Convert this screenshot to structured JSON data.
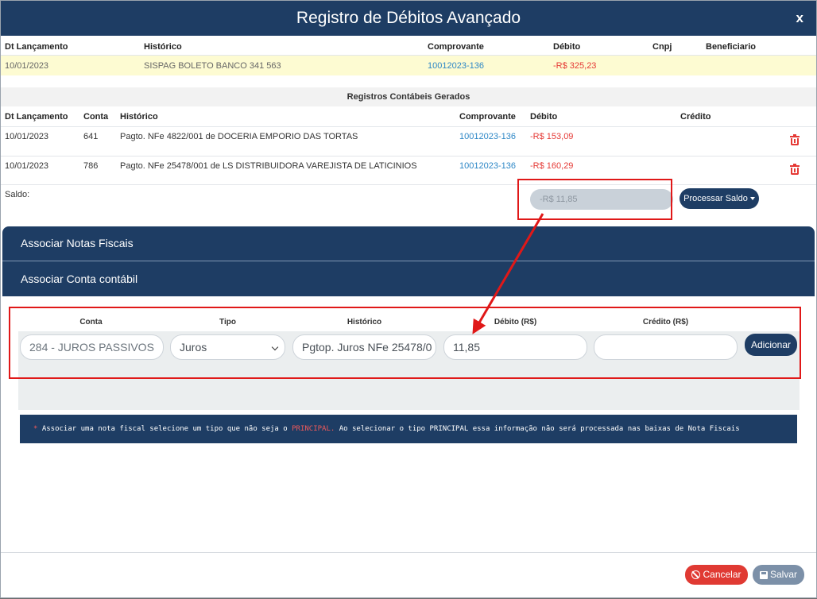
{
  "modal": {
    "title": "Registro de Débitos Avançado",
    "close_label": "x"
  },
  "top_table": {
    "headers": {
      "dt": "Dt Lançamento",
      "historico": "Histórico",
      "comprovante": "Comprovante",
      "debito": "Débito",
      "cnpj": "Cnpj",
      "beneficiario": "Beneficiario"
    },
    "row": {
      "dt": "10/01/2023",
      "historico": "SISPAG BOLETO BANCO 341 563",
      "comprovante": "10012023-136",
      "debito": "-R$ 325,23"
    }
  },
  "generated": {
    "title": "Registros Contábeis Gerados",
    "headers": {
      "dt": "Dt Lançamento",
      "conta": "Conta",
      "historico": "Histórico",
      "comprovante": "Comprovante",
      "debito": "Débito",
      "credito": "Crédito"
    },
    "rows": [
      {
        "dt": "10/01/2023",
        "conta": "641",
        "historico": "Pagto. NFe 4822/001 de DOCERIA EMPORIO DAS TORTAS",
        "comprovante": "10012023-136",
        "debito": "-R$ 153,09"
      },
      {
        "dt": "10/01/2023",
        "conta": "786",
        "historico": "Pagto. NFe 25478/001 de LS DISTRIBUIDORA VAREJISTA DE LATICINIOS",
        "comprovante": "10012023-136",
        "debito": "-R$ 160,29"
      }
    ]
  },
  "saldo": {
    "label": "Saldo:",
    "value": "-R$ 11,85",
    "processar_label": "Processar Saldo"
  },
  "accordion": {
    "notas_label": "Associar Notas Fiscais",
    "conta_label": "Associar Conta contábil"
  },
  "form": {
    "headers": {
      "conta": "Conta",
      "tipo": "Tipo",
      "historico": "Histórico",
      "debito": "Débito (R$)",
      "credito": "Crédito (R$)"
    },
    "conta_value": "284 - JUROS PASSIVOS",
    "tipo_value": "Juros",
    "historico_value": "Pgtop. Juros  NFe 25478/0",
    "debito_value": "11,85",
    "credito_value": "",
    "add_label": "Adicionar"
  },
  "info": {
    "star": "*",
    "text1": " Associar uma nota fiscal selecione um tipo que não seja o ",
    "principal1": "PRINCIPAL.",
    "text2": " Ao selecionar o tipo PRINCIPAL essa informação não será processada nas baixas de Nota Fiscais"
  },
  "footer": {
    "cancel_label": "Cancelar",
    "save_label": "Salvar"
  },
  "colors": {
    "primary": "#1e3d64",
    "danger": "#e03a33",
    "negative": "#e53935",
    "link": "#2d87c6",
    "highlight": "#fdfbd2",
    "annotation": "#e01818"
  },
  "icons": [
    "close-icon",
    "trash-icon",
    "caret-down-icon",
    "select-chevron-icon",
    "ban-icon",
    "save-icon"
  ]
}
